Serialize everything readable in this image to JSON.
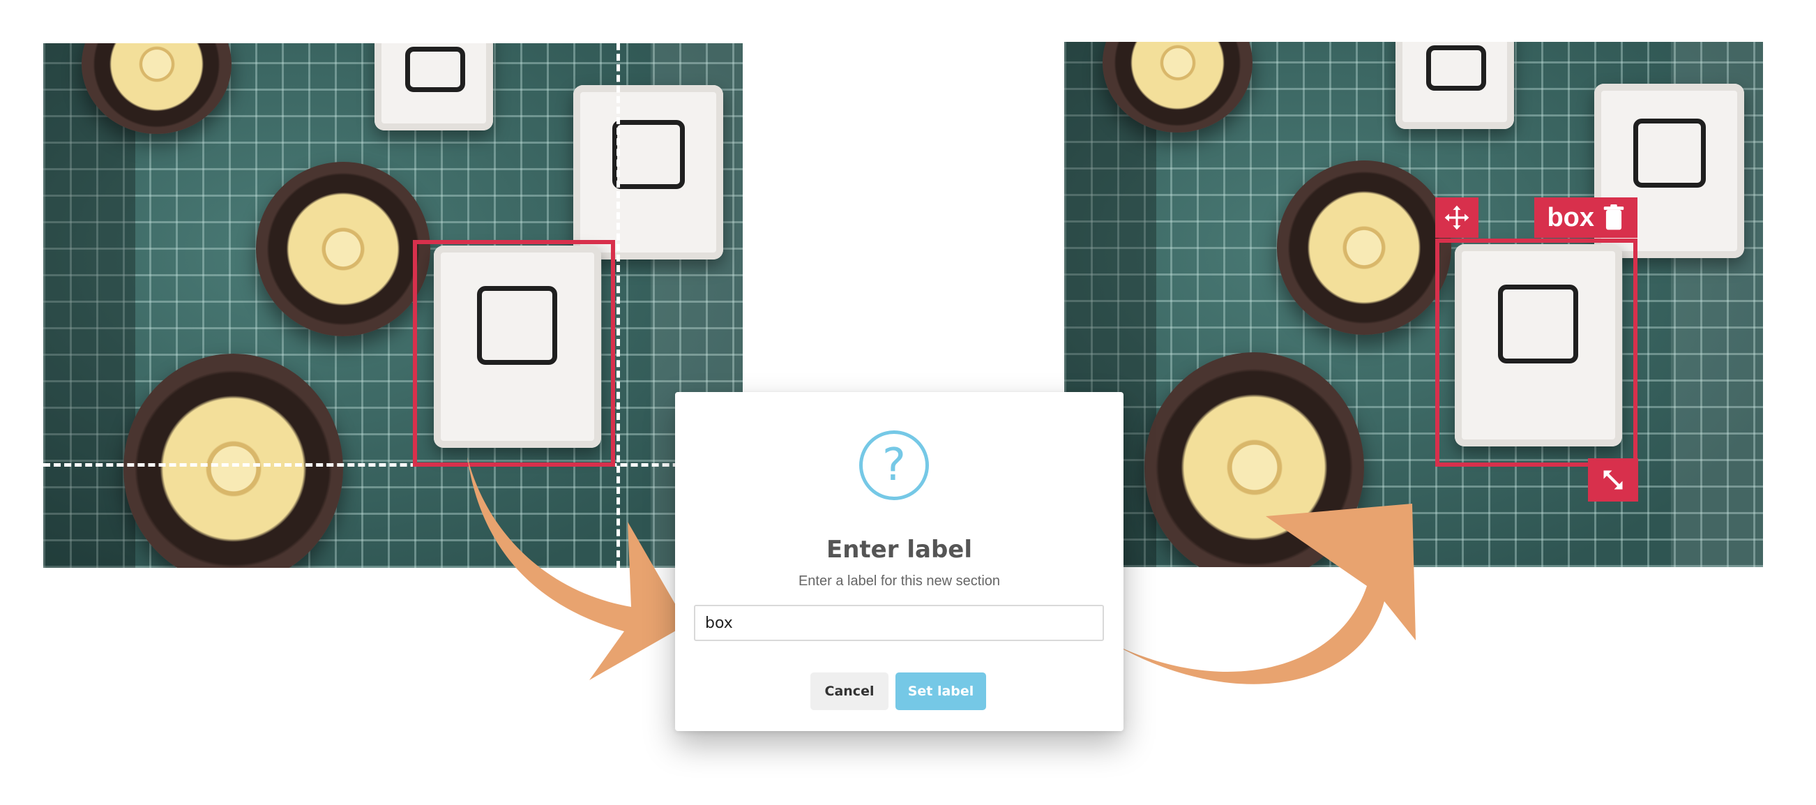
{
  "dialog": {
    "icon": "question-icon",
    "icon_glyph": "?",
    "title": "Enter label",
    "message": "Enter a label for this new section",
    "input_value": "box",
    "cancel_label": "Cancel",
    "confirm_label": "Set label"
  },
  "annotation": {
    "label": "box",
    "color": "#d8304c",
    "move_icon": "move-icon",
    "delete_icon": "trash-icon",
    "resize_icon": "resize-icon"
  },
  "colors": {
    "accent": "#75c8e6",
    "arrow": "#e8a36f",
    "box": "#d8304c"
  }
}
